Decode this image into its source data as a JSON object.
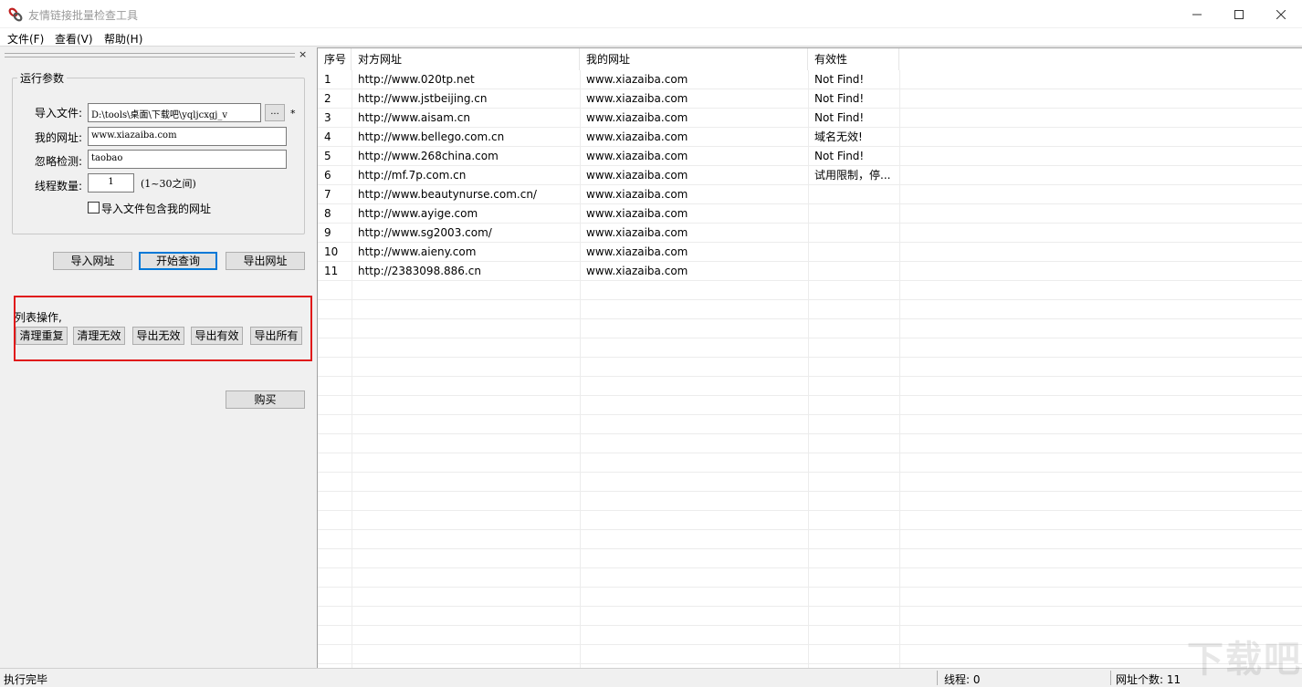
{
  "window": {
    "title": "友情链接批量检查工具",
    "controls": [
      "minimize",
      "maximize",
      "close"
    ]
  },
  "menu": [
    {
      "label": "文件(F)"
    },
    {
      "label": "查看(V)"
    },
    {
      "label": "帮助(H)"
    }
  ],
  "left": {
    "panel_close": "×",
    "group_title": "运行参数",
    "import_file_label": "导入文件:",
    "import_file_value": "D:\\tools\\桌面\\下载吧\\yqljcxgj_v",
    "browse_label": "...",
    "required_mark": "*",
    "my_url_label": "我的网址:",
    "my_url_value": "www.xiazaiba.com",
    "ignore_label": "忽略检测:",
    "ignore_value": "taobao",
    "threads_label": "线程数量:",
    "threads_value": "1",
    "threads_hint": "(1~30之间)",
    "include_checkbox_label": "导入文件包含我的网址",
    "include_checked": false,
    "btn_import": "导入网址",
    "btn_start": "开始查询",
    "btn_export": "导出网址",
    "list_ops_label": "列表操作,",
    "list_ops": [
      {
        "label": "清理重复"
      },
      {
        "label": "清理无效"
      },
      {
        "label": "导出无效"
      },
      {
        "label": "导出有效"
      },
      {
        "label": "导出所有"
      }
    ],
    "btn_buy": "购买"
  },
  "table": {
    "columns": [
      "序号",
      "对方网址",
      "我的网址",
      "有效性"
    ],
    "rows": [
      {
        "no": "1",
        "peer": "http://www.020tp.net",
        "mine": "www.xiazaiba.com",
        "status": "Not Find!"
      },
      {
        "no": "2",
        "peer": "http://www.jstbeijing.cn",
        "mine": "www.xiazaiba.com",
        "status": "Not Find!"
      },
      {
        "no": "3",
        "peer": "http://www.aisam.cn",
        "mine": "www.xiazaiba.com",
        "status": "Not Find!"
      },
      {
        "no": "4",
        "peer": "http://www.bellego.com.cn",
        "mine": "www.xiazaiba.com",
        "status": "域名无效!"
      },
      {
        "no": "5",
        "peer": "http://www.268china.com",
        "mine": "www.xiazaiba.com",
        "status": "Not Find!"
      },
      {
        "no": "6",
        "peer": "http://mf.7p.com.cn",
        "mine": "www.xiazaiba.com",
        "status": "试用限制，停..."
      },
      {
        "no": "7",
        "peer": "http://www.beautynurse.com.cn/",
        "mine": "www.xiazaiba.com",
        "status": ""
      },
      {
        "no": "8",
        "peer": "http://www.ayige.com",
        "mine": "www.xiazaiba.com",
        "status": ""
      },
      {
        "no": "9",
        "peer": "http://www.sg2003.com/",
        "mine": "www.xiazaiba.com",
        "status": ""
      },
      {
        "no": "10",
        "peer": "http://www.aieny.com",
        "mine": "www.xiazaiba.com",
        "status": ""
      },
      {
        "no": "11",
        "peer": "http://2383098.886.cn",
        "mine": "www.xiazaiba.com",
        "status": ""
      }
    ]
  },
  "status": {
    "left": "执行完毕",
    "threads": "线程: 0",
    "url_count": "网址个数: 11"
  },
  "watermark": "下载吧",
  "colors": {
    "highlight": "#e0191a",
    "focus": "#0078d7"
  }
}
